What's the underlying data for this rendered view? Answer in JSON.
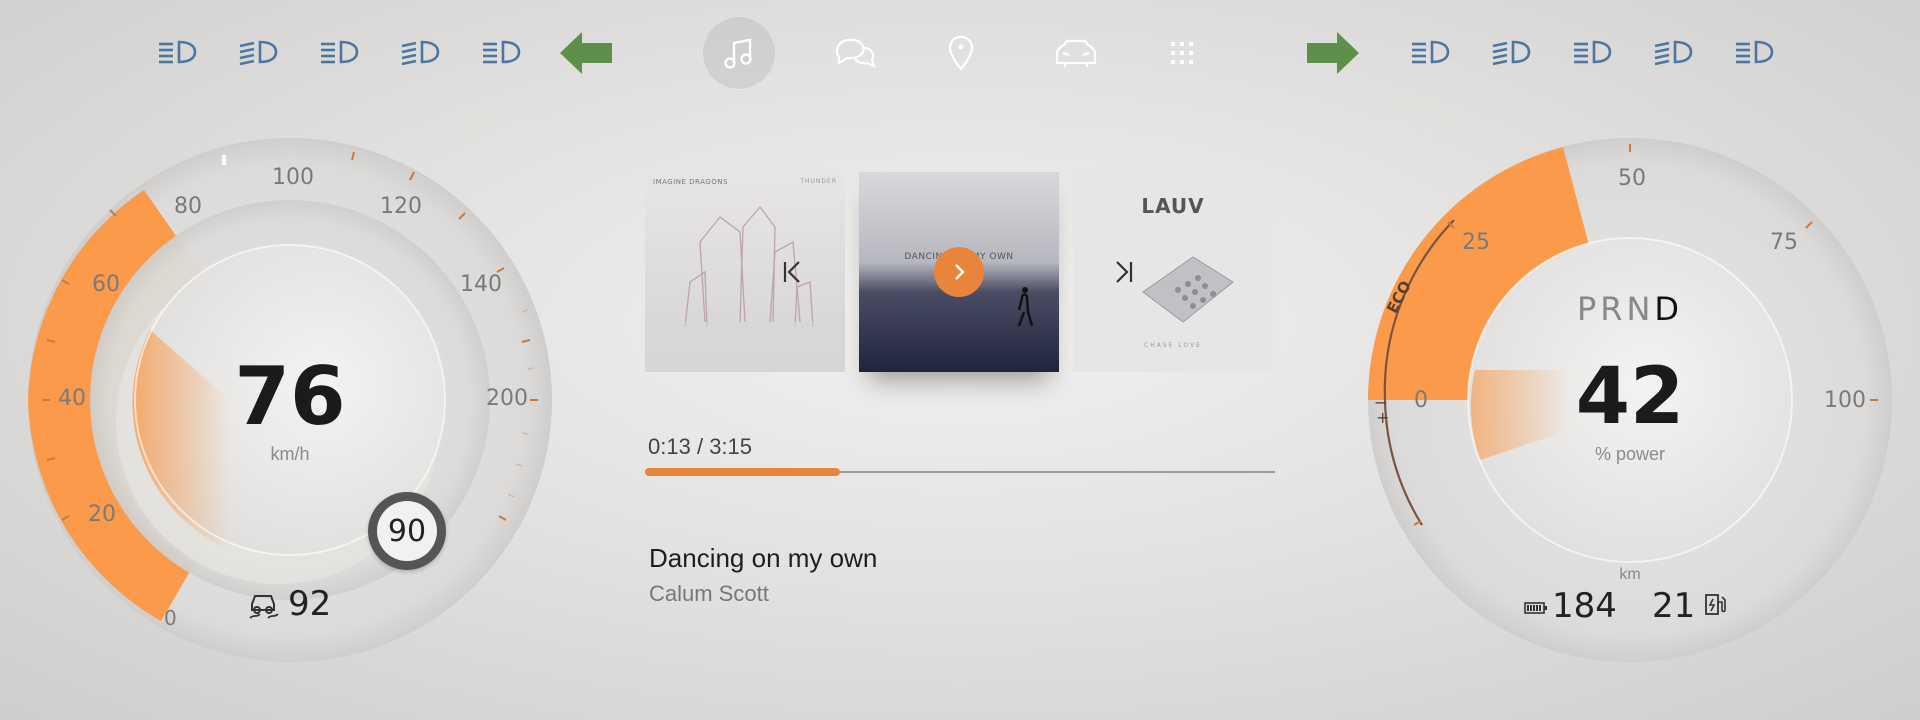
{
  "top_bar": {
    "nav_items": [
      {
        "name": "music-icon",
        "active": true
      },
      {
        "name": "chat-icon",
        "active": false
      },
      {
        "name": "location-icon",
        "active": false
      },
      {
        "name": "car-icon",
        "active": false
      },
      {
        "name": "apps-icon",
        "active": false
      }
    ],
    "left_indicators": [
      "headlight-icon",
      "headlight-icon",
      "headlight-icon",
      "headlight-icon",
      "headlight-icon"
    ],
    "right_indicators": [
      "headlight-icon",
      "headlight-icon",
      "headlight-icon",
      "headlight-icon",
      "headlight-icon"
    ],
    "turn_signal_color": "#5e8f4b",
    "headlight_color": "#4c76a0"
  },
  "speedometer": {
    "speed": "76",
    "unit": "km/h",
    "speed_limit": "90",
    "range_value": "92",
    "ticks": [
      "0",
      "20",
      "40",
      "60",
      "80",
      "100",
      "120",
      "140",
      "200"
    ],
    "accent_color": "#fa9a4a"
  },
  "power_gauge": {
    "gears": [
      "P",
      "R",
      "N",
      "D"
    ],
    "selected_gear": "D",
    "power": "42",
    "unit": "% power",
    "ticks": [
      "0",
      "25",
      "50",
      "75",
      "100"
    ],
    "eco_label": "ECO",
    "range_unit": "km",
    "battery_range": "184",
    "charge_value": "21"
  },
  "media": {
    "elapsed": "0:13",
    "duration": "3:15",
    "progress_fraction": 0.31,
    "title": "Dancing on my own",
    "artist": "Calum Scott",
    "albums": [
      {
        "name": "album-thunder",
        "band": "IMAGINE DRAGONS",
        "title": "THUNDER"
      },
      {
        "name": "album-dancing-on-my-own",
        "cover_text": "DANCING ON MY OWN"
      },
      {
        "name": "album-lauv",
        "band": "LAUV",
        "title": "CHASE LOVE"
      }
    ],
    "accent_color": "#e8843c"
  }
}
